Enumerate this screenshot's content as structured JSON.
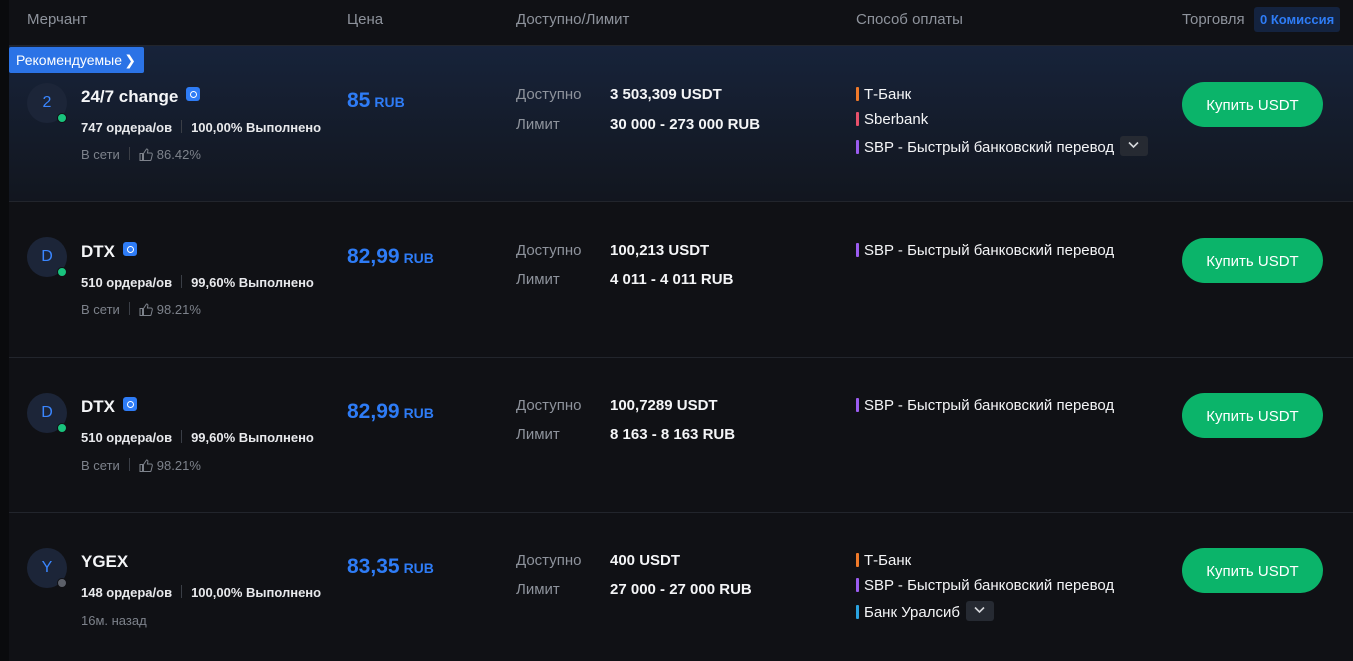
{
  "header": {
    "merchant": "Мерчант",
    "price": "Цена",
    "available_limit": "Доступно/Лимит",
    "payment_method": "Способ оплаты",
    "trade": "Торговля",
    "fee_badge": "0 Комиссия"
  },
  "recommended_badge": "Рекомендуемые",
  "labels": {
    "available": "Доступно",
    "limit": "Лимит",
    "buy": "Купить USDT"
  },
  "colors": {
    "accent": "#2e7cf6",
    "buy": "#0bb46a",
    "online": "#19c37d"
  },
  "rows": [
    {
      "avatar": "2",
      "name": "24/7 change",
      "orders": "747 ордера/ов",
      "completion": "100,00% Выполнено",
      "status": "В сети",
      "rating": "86.42%",
      "price": "85",
      "currency": "RUB",
      "available": "3 503,309 USDT",
      "limit": "30 000 - 273 000 RUB",
      "payments": [
        "Т-Банк",
        "Sberbank",
        "SBP - Быстрый банковский перевод"
      ]
    },
    {
      "avatar": "D",
      "name": "DTX",
      "orders": "510 ордера/ов",
      "completion": "99,60% Выполнено",
      "status": "В сети",
      "rating": "98.21%",
      "price": "82,99",
      "currency": "RUB",
      "available": "100,213 USDT",
      "limit": "4 011 - 4 011 RUB",
      "payments": [
        "SBP - Быстрый банковский перевод"
      ]
    },
    {
      "avatar": "D",
      "name": "DTX",
      "orders": "510 ордера/ов",
      "completion": "99,60% Выполнено",
      "status": "В сети",
      "rating": "98.21%",
      "price": "82,99",
      "currency": "RUB",
      "available": "100,7289 USDT",
      "limit": "8 163 - 8 163 RUB",
      "payments": [
        "SBP - Быстрый банковский перевод"
      ]
    },
    {
      "avatar": "Y",
      "name": "YGEX",
      "orders": "148 ордера/ов",
      "completion": "100,00% Выполнено",
      "status": "16м. назад",
      "price": "83,35",
      "currency": "RUB",
      "available": "400 USDT",
      "limit": "27 000 - 27 000 RUB",
      "payments": [
        "Т-Банк",
        "SBP - Быстрый банковский перевод",
        "Банк Уралсиб"
      ]
    }
  ]
}
